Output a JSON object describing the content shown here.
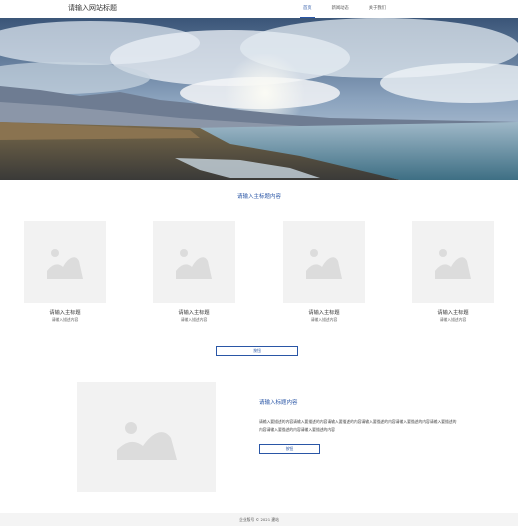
{
  "header": {
    "site_title": "请输入网站标题",
    "nav": [
      {
        "label": "首页",
        "active": true
      },
      {
        "label": "新闻动态",
        "active": false
      },
      {
        "label": "关于我们",
        "active": false
      }
    ]
  },
  "hero": {
    "icon": "landscape-photo"
  },
  "section": {
    "title": "请输入主标题内容"
  },
  "cards": [
    {
      "title": "请输入主标题",
      "subtitle": "请输入描述内容"
    },
    {
      "title": "请输入主标题",
      "subtitle": "请输入描述内容"
    },
    {
      "title": "请输入主标题",
      "subtitle": "请输入描述内容"
    },
    {
      "title": "请输入主标题",
      "subtitle": "请输入描述内容"
    }
  ],
  "more_button": "按钮",
  "feature": {
    "title": "请输入标题内容",
    "description": "请输入要描述的内容请输入要描述的内容请输入要描述的内容请输入要描述的内容请输入要描述的内容请输入要描述的内容请输入要描述的内容请输入要描述的内容",
    "button": "按钮"
  },
  "footer": {
    "text": "企业版号 © 2021 建站"
  },
  "colors": {
    "accent": "#2a56a6",
    "placeholder_bg": "#f2f2f2",
    "placeholder_icon": "#dcdcdc"
  }
}
